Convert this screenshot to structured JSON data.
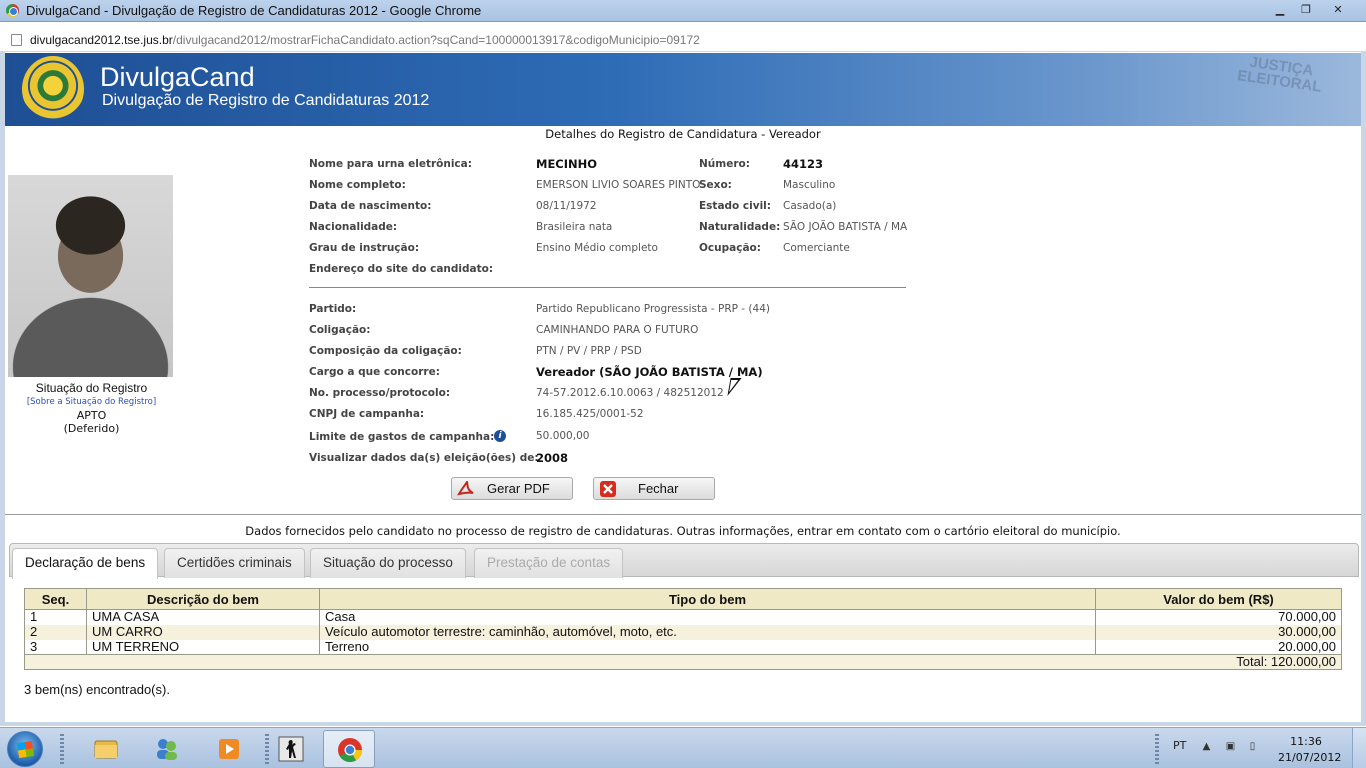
{
  "window": {
    "title": "DivulgaCand - Divulgação de Registro de Candidaturas 2012 - Google Chrome",
    "min_label": "▁",
    "max_label": "❐",
    "close_label": "✕"
  },
  "address": {
    "host": "divulgacand2012.tse.jus.br",
    "path": "/divulgacand2012/mostrarFichaCandidato.action?sqCand=100000013917&codigoMunicipio=09172"
  },
  "banner": {
    "brand": "DivulgaCand",
    "subtitle": "Divulgação de Registro de Candidaturas 2012",
    "watermark_line1": "JUSTIÇA",
    "watermark_line2": "ELEITORAL"
  },
  "page_heading": "Detalhes do Registro de Candidatura - Vereador",
  "situation": {
    "label": "Situação do Registro",
    "link": "[Sobre a Situação do Registro]",
    "status": "APTO",
    "detail": "(Deferido)"
  },
  "candidate": {
    "urna_label": "Nome para urna eletrônica:",
    "urna": "MECINHO",
    "numero_label": "Número:",
    "numero": "44123",
    "nome_label": "Nome completo:",
    "nome": "EMERSON LIVIO SOARES PINTO",
    "sexo_label": "Sexo:",
    "sexo": "Masculino",
    "nasc_label": "Data de nascimento:",
    "nasc": "08/11/1972",
    "civil_label": "Estado civil:",
    "civil": "Casado(a)",
    "nacionalidade_label": "Nacionalidade:",
    "nacionalidade": "Brasileira nata",
    "naturalidade_label": "Naturalidade:",
    "naturalidade": "SÃO JOÃO BATISTA / MA",
    "grau_label": "Grau de instrução:",
    "grau": "Ensino Médio completo",
    "ocupacao_label": "Ocupação:",
    "ocupacao": "Comerciante",
    "site_label": "Endereço do site do candidato:",
    "partido_label": "Partido:",
    "partido": "Partido Republicano Progressista - PRP - (44)",
    "coligacao_label": "Coligação:",
    "coligacao": "CAMINHANDO PARA O FUTURO",
    "composicao_label": "Composição da coligação:",
    "composicao": "PTN / PV / PRP / PSD",
    "cargo_label": "Cargo a que concorre:",
    "cargo": "Vereador (SÃO JOÃO BATISTA / MA)",
    "processo_label": "No. processo/protocolo:",
    "processo": "74-57.2012.6.10.0063 / 482512012",
    "cnpj_label": "CNPJ de campanha:",
    "cnpj": "16.185.425/0001-52",
    "limite_label": "Limite de gastos de campanha:",
    "limite": "50.000,00",
    "visualizar_label": "Visualizar dados da(s) eleição(ões) de:",
    "visualizar": "2008"
  },
  "buttons": {
    "pdf": "Gerar PDF",
    "fechar": "Fechar"
  },
  "notice": "Dados fornecidos pelo candidato no processo de registro de candidaturas.  Outras informações, entrar em contato com o cartório eleitoral do município.",
  "tabs": [
    {
      "label": "Declaração de bens"
    },
    {
      "label": "Certidões criminais"
    },
    {
      "label": "Situação do processo"
    },
    {
      "label": "Prestação de contas"
    }
  ],
  "table": {
    "headers": [
      "Seq.",
      "Descrição do bem",
      "Tipo do bem",
      "Valor do bem (R$)"
    ],
    "rows": [
      {
        "seq": "1",
        "desc": "UMA CASA",
        "tipo": "Casa",
        "valor": "70.000,00"
      },
      {
        "seq": "2",
        "desc": "UM CARRO",
        "tipo": "Veículo automotor terrestre: caminhão, automóvel, moto, etc.",
        "valor": "30.000,00"
      },
      {
        "seq": "3",
        "desc": "UM TERRENO",
        "tipo": "Terreno",
        "valor": "20.000,00"
      }
    ],
    "total": "Total: 120.000,00"
  },
  "found": "3 bem(ns) encontrado(s).",
  "taskbar": {
    "lang": "PT",
    "time": "11:36",
    "date": "21/07/2012"
  }
}
